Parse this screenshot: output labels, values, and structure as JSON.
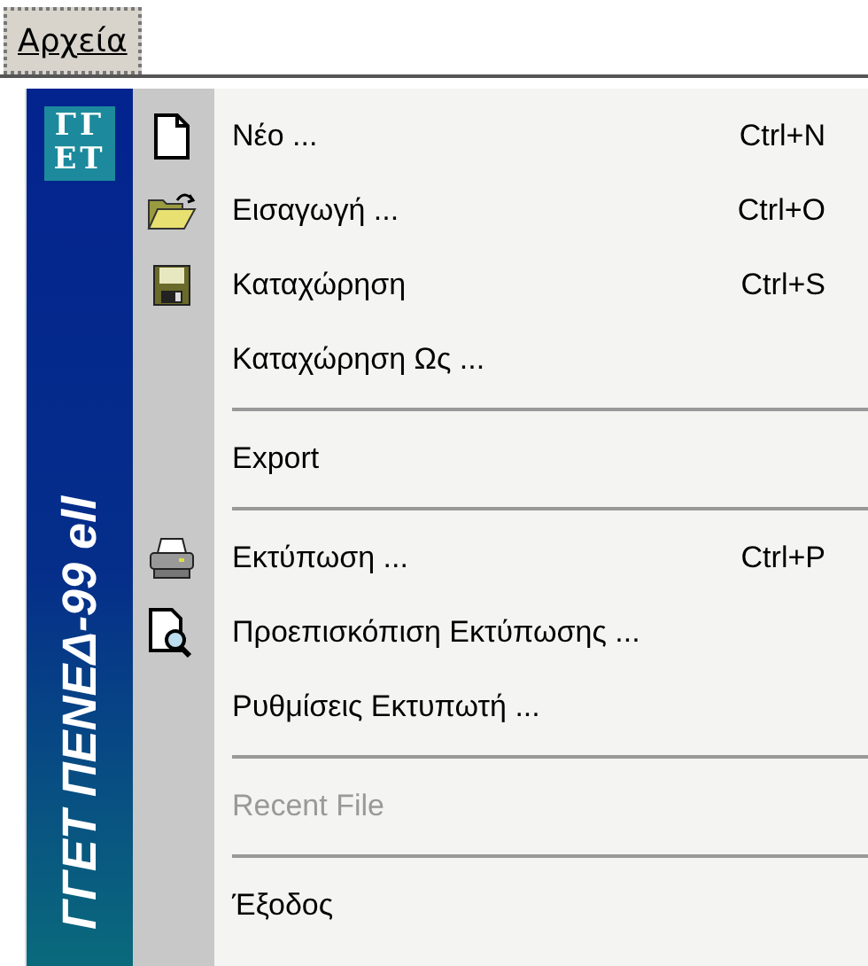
{
  "menu_bar": {
    "items": [
      {
        "label": "Αρχεία",
        "selected": true
      }
    ]
  },
  "menu": {
    "banner": {
      "logo": [
        "ΓΓ",
        "ΕΤ"
      ],
      "title": "ΓΓΕΤ ΠΕΝΕΔ-99 ell"
    },
    "items": [
      {
        "kind": "item",
        "label": "Νέο ...",
        "shortcut": "Ctrl+N",
        "disabled": false
      },
      {
        "kind": "item",
        "label": "Εισαγωγή ...",
        "shortcut": "Ctrl+O",
        "disabled": false
      },
      {
        "kind": "item",
        "label": "Καταχώρηση",
        "shortcut": "Ctrl+S",
        "disabled": false
      },
      {
        "kind": "item",
        "label": "Καταχώρηση Ως ...",
        "disabled": false
      },
      {
        "kind": "separator"
      },
      {
        "kind": "item",
        "label": "Export",
        "disabled": false
      },
      {
        "kind": "separator"
      },
      {
        "kind": "item",
        "label": "Εκτύπωση ...",
        "shortcut": "Ctrl+P",
        "disabled": false
      },
      {
        "kind": "item",
        "label": "Προεπισκόπιση Εκτύπωσης ...",
        "disabled": false
      },
      {
        "kind": "item",
        "label": "Ρυθμίσεις Εκτυπωτή ...",
        "disabled": false
      },
      {
        "kind": "separator"
      },
      {
        "kind": "item",
        "label": "Recent File",
        "disabled": true
      },
      {
        "kind": "separator"
      },
      {
        "kind": "item",
        "label": "Έξοδος",
        "disabled": false
      }
    ]
  }
}
